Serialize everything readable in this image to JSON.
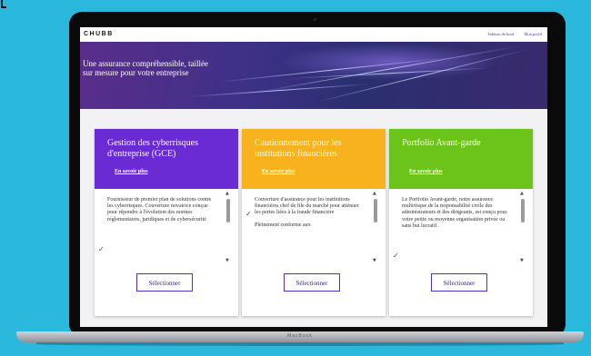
{
  "header": {
    "logo": "CHUBB",
    "nav": [
      "Tableau de bord",
      "Mon profil"
    ]
  },
  "hero": {
    "title": "Une assurance compréhensible, taillée sur mesure pour votre entreprise"
  },
  "cards": [
    {
      "title": "Gestion des cyberrisques d'entreprise (GCE)",
      "link": "En savoir plus",
      "body": [
        "Fournisseur de premier plan de solutions contre les cyberrisques. Couverture novatrice conçue pour répondre à l'évolution des normes réglementaires, juridiques et de cybersécurité"
      ],
      "button": "Sélectionner",
      "color": "#6a2bd4"
    },
    {
      "title": "Cautionnement pour les institutions financières",
      "link": "En savoir plus",
      "body": [
        "Couverture d'assurance pour les institutions financières chef de file du marché pour atténuer les pertes liées à la fraude financière",
        "Pleinement conforme aux"
      ],
      "button": "Sélectionner",
      "color": "#f7b21d"
    },
    {
      "title": "Portfolio Avant-garde",
      "link": "En savoir plus",
      "body": [
        "Le Portfolio Avant-garde, notre assurance multirisque de la responsabilité civile des administrateurs et des dirigeants, est conçu pour votre petite ou moyenne organisation privée ou sans but lucratif."
      ],
      "button": "Sélectionner",
      "color": "#6cc41a"
    }
  ],
  "device": {
    "brand": "MacBook"
  },
  "icons": {
    "check": "checkmark-icon",
    "scroll_up": "scroll-up-arrow-icon",
    "scroll_down": "scroll-down-arrow-icon"
  },
  "colors": {
    "background": "#2bb8dd",
    "accent": "#5a2bbf"
  }
}
